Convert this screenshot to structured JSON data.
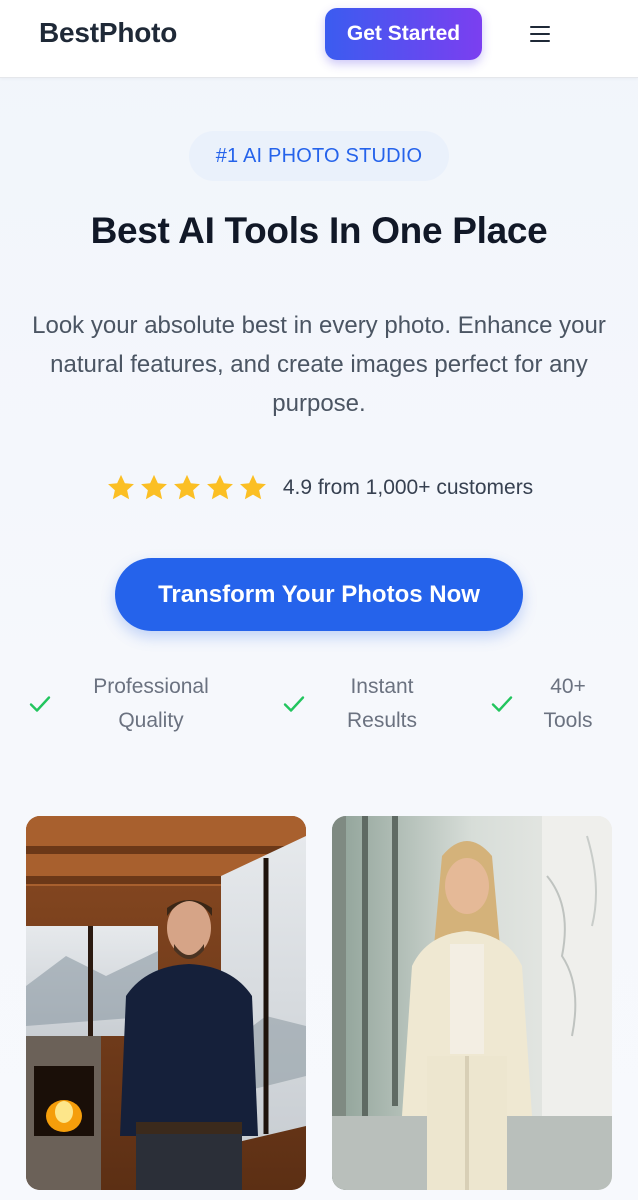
{
  "header": {
    "logo": "BestPhoto",
    "cta_label": "Get Started"
  },
  "hero": {
    "badge": "#1 AI PHOTO STUDIO",
    "headline": "Best AI Tools In One Place",
    "subtitle": "Look your absolute best in every photo. Enhance your natural features, and create images perfect for any purpose.",
    "rating": {
      "stars": 5,
      "text": "4.9 from 1,000+ customers"
    },
    "cta_label": "Transform Your Photos Now"
  },
  "features": [
    {
      "line1": "Professional",
      "line2": "Quality"
    },
    {
      "line1": "Instant",
      "line2": "Results"
    },
    {
      "line1": "40+",
      "line2": "Tools"
    }
  ],
  "photos": [
    {
      "alt": "man-in-cabin-photo"
    },
    {
      "alt": "woman-in-white-suit-photo"
    }
  ],
  "colors": {
    "accent": "#2563eb",
    "gradient_start": "#3b5cf0",
    "gradient_end": "#7b3ff0",
    "star": "#fbbf24",
    "check": "#22c55e"
  },
  "icons": [
    "menu-icon",
    "star-icon",
    "check-icon"
  ]
}
